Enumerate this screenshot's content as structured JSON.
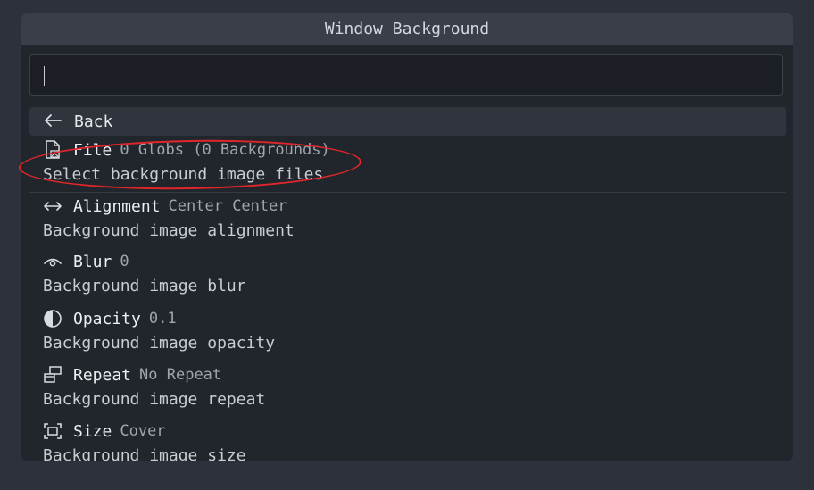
{
  "window": {
    "title": "Window Background"
  },
  "search": {
    "value": "",
    "placeholder": ""
  },
  "back": {
    "icon": "arrow-left-icon",
    "label": "Back"
  },
  "items": [
    {
      "icon": "file-image-icon",
      "name": "File",
      "value": "0 Globs (0 Backgrounds)",
      "description": "Select background image files"
    },
    {
      "icon": "arrows-horizontal-icon",
      "name": "Alignment",
      "value": "Center Center",
      "description": "Background image alignment"
    },
    {
      "icon": "eye-icon",
      "name": "Blur",
      "value": "0",
      "description": "Background image blur"
    },
    {
      "icon": "half-circle-icon",
      "name": "Opacity",
      "value": "0.1",
      "description": "Background image opacity"
    },
    {
      "icon": "repeat-windows-icon",
      "name": "Repeat",
      "value": "No Repeat",
      "description": "Background image repeat"
    },
    {
      "icon": "frame-size-icon",
      "name": "Size",
      "value": "Cover",
      "description": "Background image size"
    }
  ],
  "colors": {
    "background": "#2d313c",
    "panel": "#21252c",
    "titlebar": "#3a3e48",
    "annotation": "#e0262a"
  }
}
